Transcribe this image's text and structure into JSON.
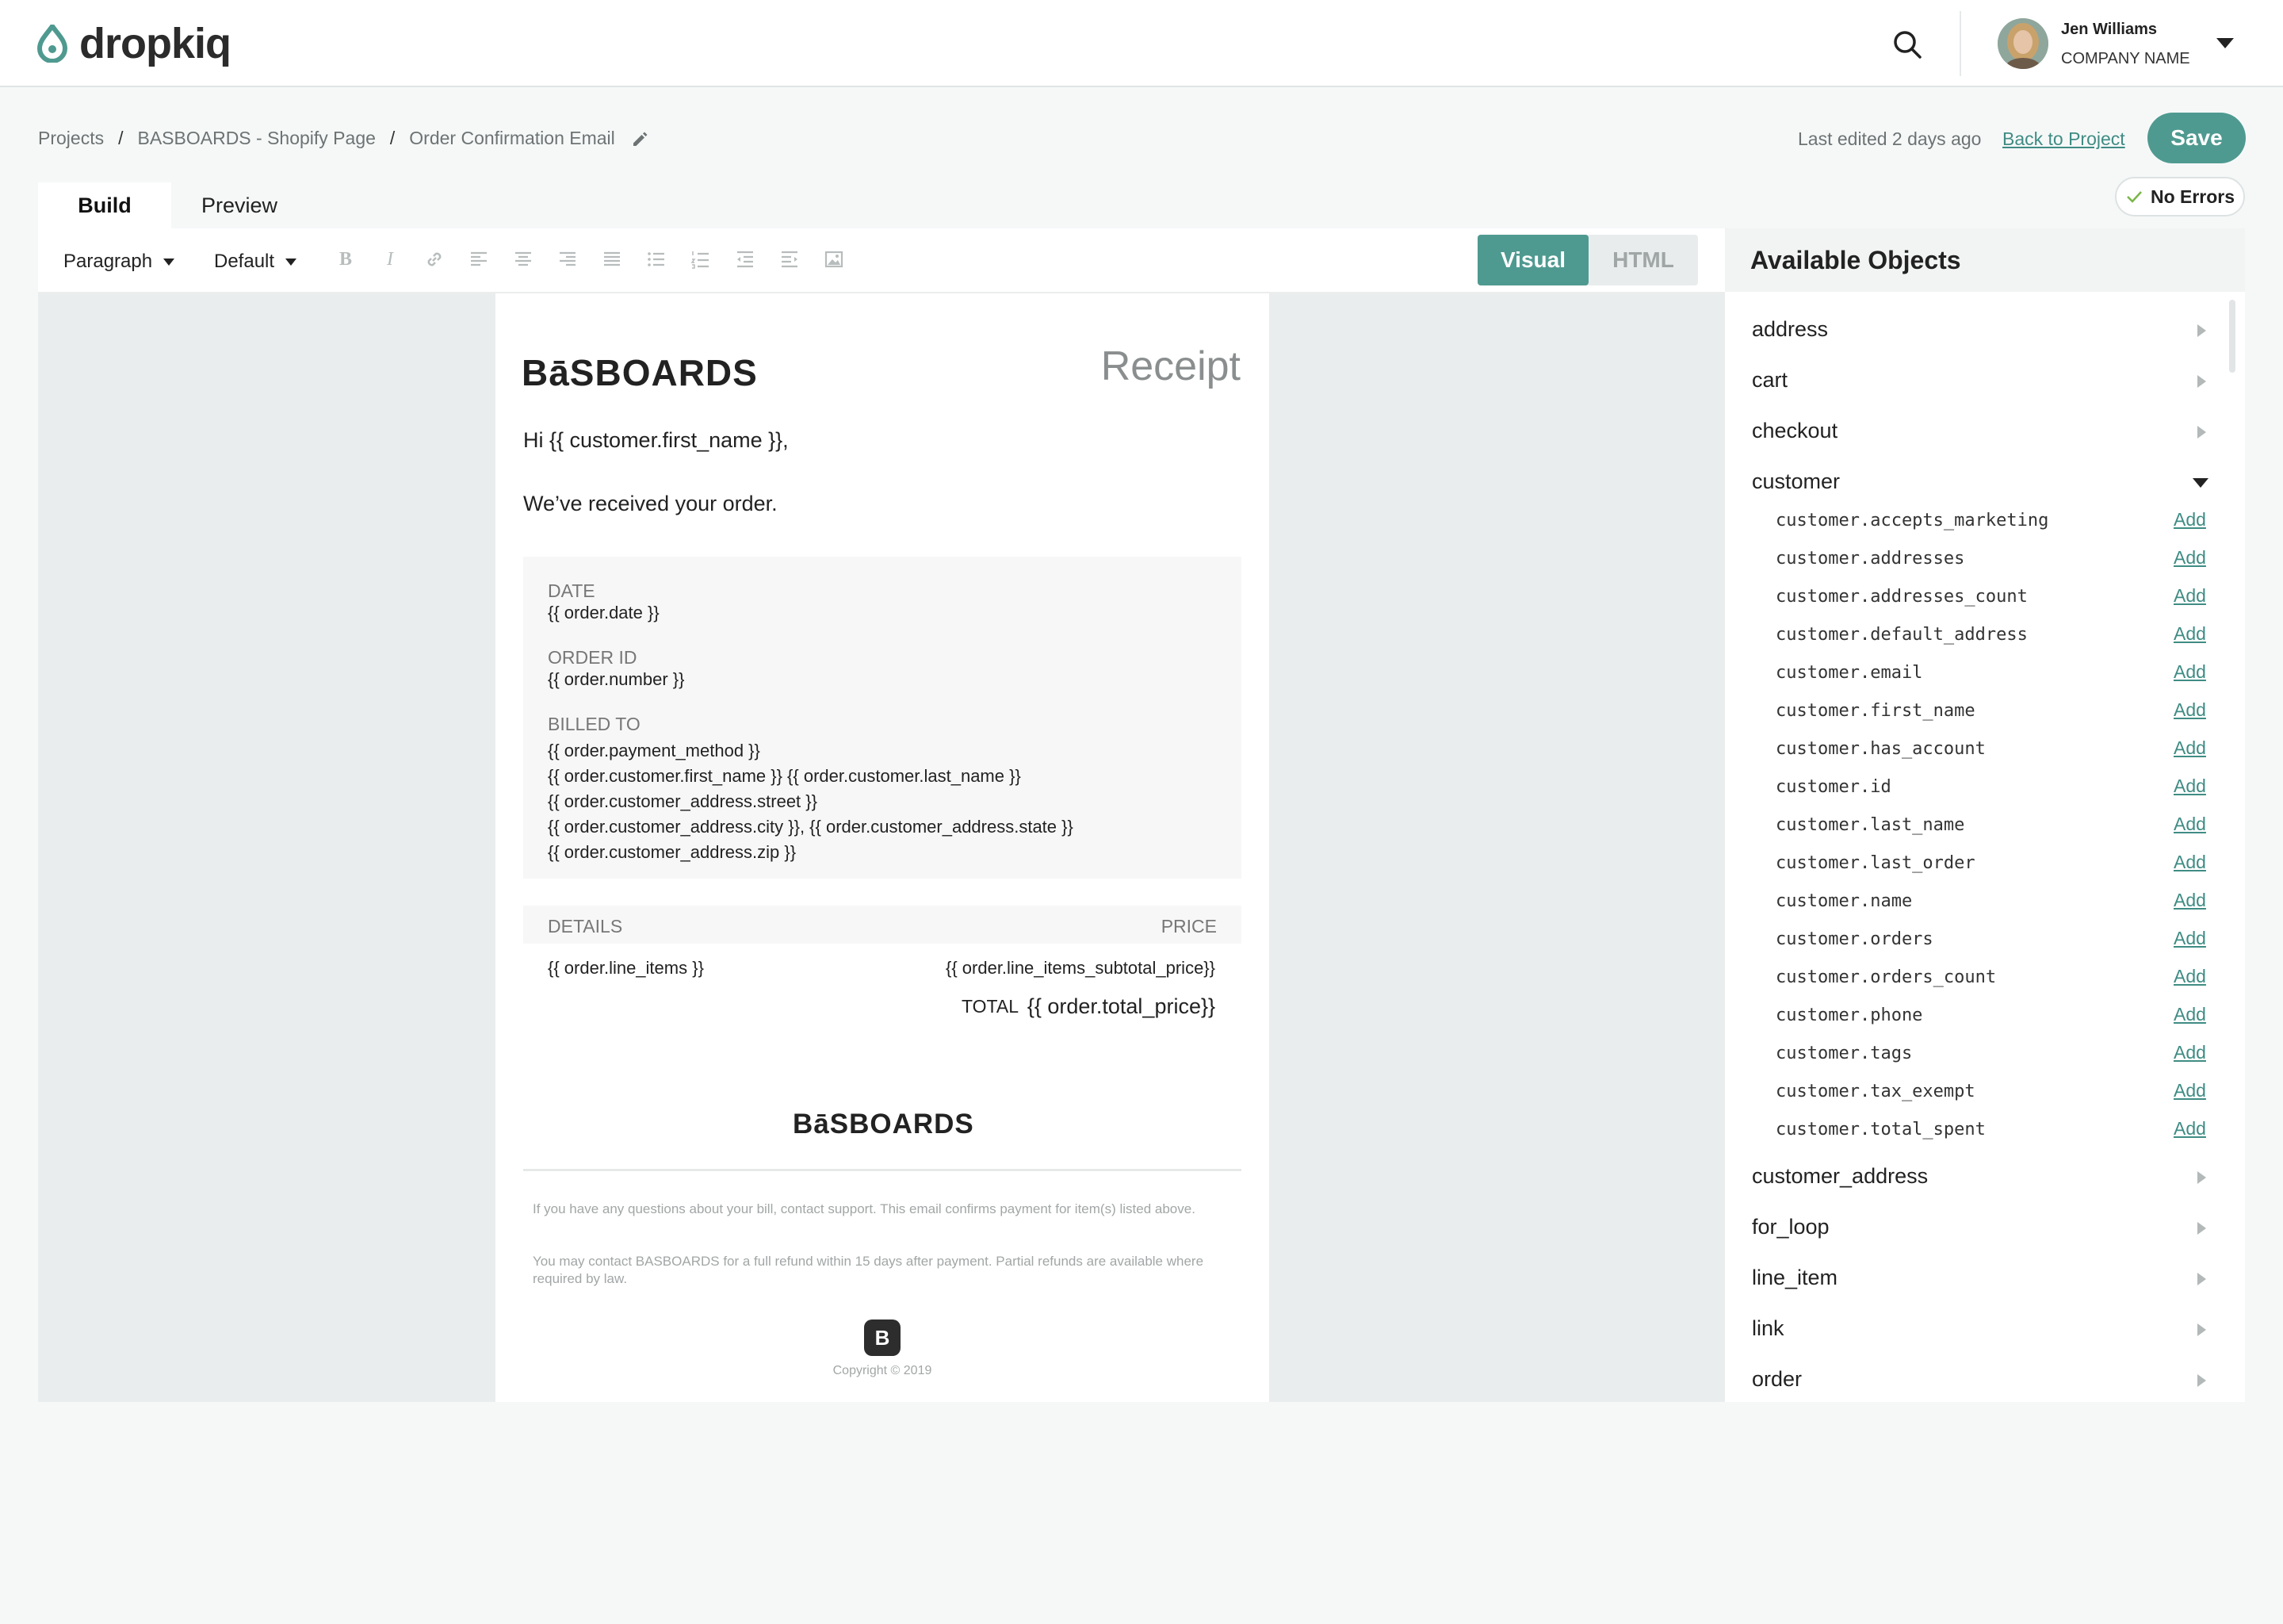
{
  "app": {
    "name": "dropkiq",
    "user_name": "Jen Williams",
    "company": "COMPANY NAME",
    "accent_color": "#4f9a90"
  },
  "breadcrumb": [
    "Projects",
    "BASBOARDS - Shopify Page",
    "Order Confirmation Email"
  ],
  "header_actions": {
    "last_edited": "Last edited 2 days ago",
    "back_link": "Back to Project",
    "save": "Save",
    "status": "No Errors"
  },
  "tabs": {
    "build": "Build",
    "preview": "Preview",
    "active": "Build"
  },
  "toolbar": {
    "paragraph": "Paragraph",
    "font": "Default",
    "icons": [
      "bold-icon",
      "italic-icon",
      "link-icon",
      "align-left-icon",
      "align-center-icon",
      "align-right-icon",
      "align-justify-icon",
      "bullet-list-icon",
      "numbered-list-icon",
      "outdent-icon",
      "indent-icon",
      "image-icon"
    ],
    "mode_visual": "Visual",
    "mode_html": "HTML",
    "active_mode": "Visual"
  },
  "email": {
    "brand": "BāSBOARDS",
    "receipt": "Receipt",
    "greeting": "Hi {{ customer.first_name }},",
    "received": "We’ve received your order.",
    "date_label": "DATE",
    "date_value": "{{ order.date }}",
    "order_label": "ORDER ID",
    "order_value": "{{ order.number }}",
    "billed_label": "BILLED TO",
    "billed_lines": [
      "{{ order.payment_method }}",
      "{{ order.customer.first_name }} {{ order.customer.last_name }}",
      "{{ order.customer_address.street }}",
      "{{ order.customer_address.city }}, {{ order.customer_address.state }}",
      "{{ order.customer_address.zip }}"
    ],
    "details_label": "DETAILS",
    "price_label": "PRICE",
    "line_items": "{{ order.line_items }}",
    "subtotal": "{{ order.line_items_subtotal_price}}",
    "total_label": "TOTAL",
    "total_value": "{{ order.total_price}}",
    "fine_print_1": "If you have any questions about your bill, contact support. This email confirms payment for item(s) listed above.",
    "fine_print_2": "You may contact BASBOARDS for a full refund within 15 days after payment. Partial refunds are available where required by law.",
    "mark": "B",
    "copyright": "Copyright © 2019"
  },
  "panel": {
    "title": "Available Objects",
    "objects_before": [
      "address",
      "cart",
      "checkout"
    ],
    "expanded": "customer",
    "add_label": "Add",
    "properties": [
      "customer.accepts_marketing",
      "customer.addresses",
      "customer.addresses_count",
      "customer.default_address",
      "customer.email",
      "customer.first_name",
      "customer.has_account",
      "customer.id",
      "customer.last_name",
      "customer.last_order",
      "customer.name",
      "customer.orders",
      "customer.orders_count",
      "customer.phone",
      "customer.tags",
      "customer.tax_exempt",
      "customer.total_spent"
    ],
    "objects_after": [
      "customer_address",
      "for_loop",
      "line_item",
      "link",
      "order"
    ]
  }
}
